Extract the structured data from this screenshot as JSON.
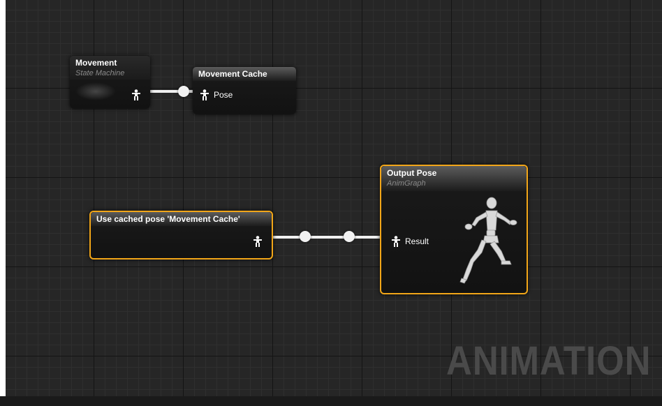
{
  "graph": {
    "watermark": "ANIMATION"
  },
  "nodes": {
    "movement": {
      "title": "Movement",
      "subtitle": "State Machine",
      "output_icon": "pose-pin-icon"
    },
    "movement_cache": {
      "title": "Movement Cache",
      "input_label": "Pose",
      "input_icon": "pose-pin-icon"
    },
    "use_cached_pose": {
      "title": "Use cached pose 'Movement Cache'",
      "output_icon": "pose-pin-icon"
    },
    "output_pose": {
      "title": "Output Pose",
      "subtitle": "AnimGraph",
      "input_label": "Result",
      "input_icon": "pose-pin-icon",
      "preview_icon": "running-mannequin-icon"
    }
  },
  "colors": {
    "selection": "#f2a618",
    "wire": "#f0f0f0",
    "grid_background": "#262626"
  }
}
